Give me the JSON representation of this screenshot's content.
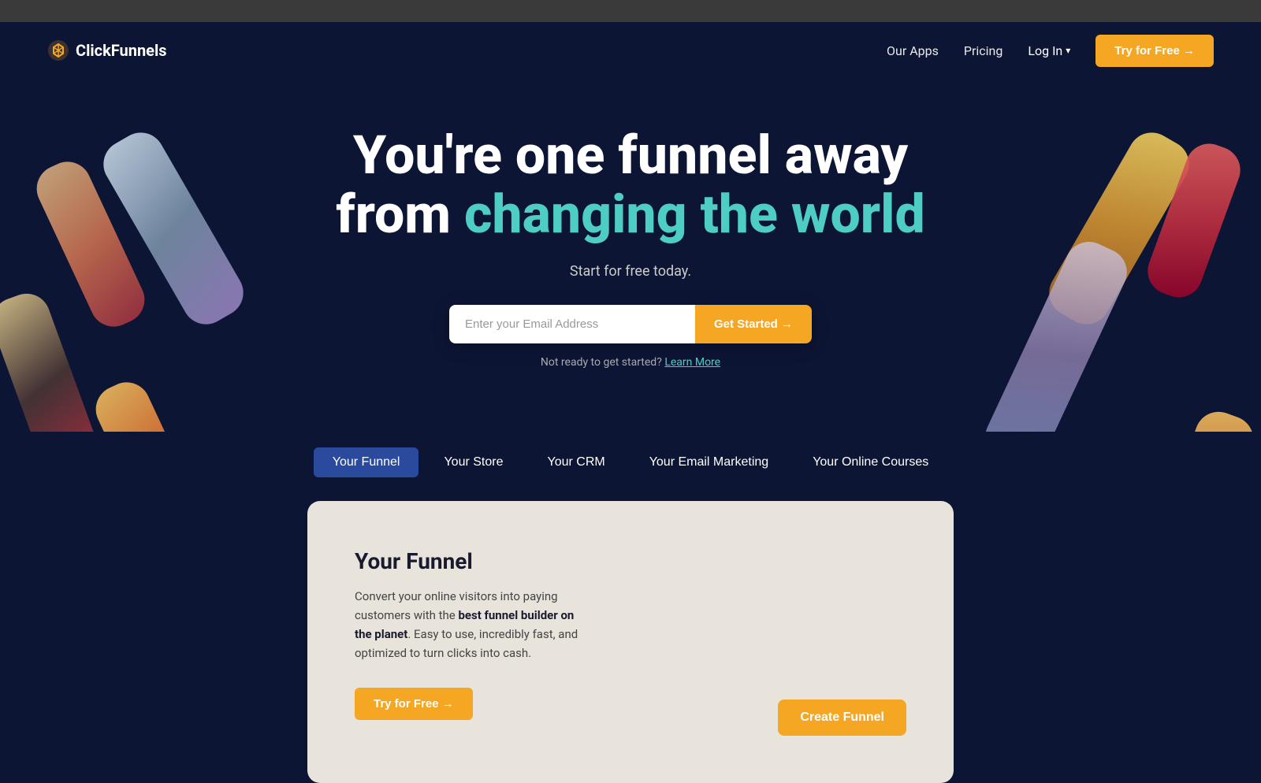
{
  "browser": {
    "bar_bg": "#3a3a3a"
  },
  "navbar": {
    "logo_text": "ClickFunnels",
    "nav_links": [
      {
        "label": "Our Apps",
        "id": "our-apps"
      },
      {
        "label": "Pricing",
        "id": "pricing"
      },
      {
        "label": "Log In",
        "id": "login",
        "has_chevron": true
      }
    ],
    "cta_label": "Try for Free →"
  },
  "hero": {
    "headline_part1": "You're one funnel away",
    "headline_part2": "from ",
    "headline_highlight": "changing the world",
    "subtitle": "Start for free today.",
    "email_placeholder": "Enter your Email Address",
    "get_started_label": "Get Started →",
    "not_ready_text": "Not ready to get started?",
    "learn_more_label": "Learn More"
  },
  "tabs": [
    {
      "label": "Your Funnel",
      "id": "your-funnel",
      "active": true
    },
    {
      "label": "Your Store",
      "id": "your-store",
      "active": false
    },
    {
      "label": "Your CRM",
      "id": "your-crm",
      "active": false
    },
    {
      "label": "Your Email Marketing",
      "id": "your-email",
      "active": false
    },
    {
      "label": "Your Online Courses",
      "id": "your-courses",
      "active": false
    }
  ],
  "card": {
    "title": "Your Funnel",
    "description_plain": "Convert your online visitors into paying customers with the ",
    "description_bold": "best funnel builder on the planet",
    "description_suffix": ". Easy to use, incredibly fast, and optimized to turn clicks into cash.",
    "try_free_label": "Try for Free →",
    "create_button_label": "Create Funnel"
  },
  "colors": {
    "accent": "#f5a623",
    "teal": "#4ecdc4",
    "bg": "#0d1535",
    "card_bg": "#e8e4dc"
  }
}
